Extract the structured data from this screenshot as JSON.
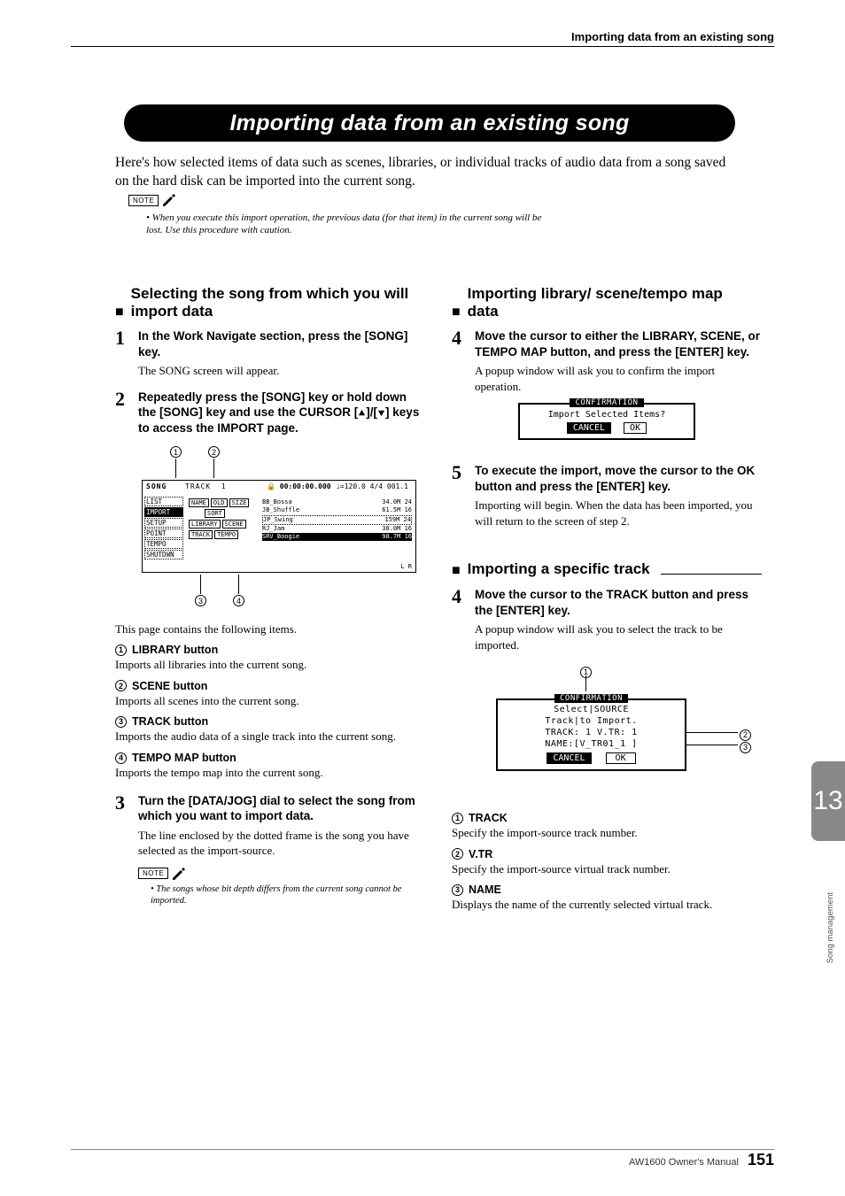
{
  "runhead": "Importing data from an existing song",
  "title": "Importing data from an existing song",
  "intro": "Here's how selected items of data such as scenes, libraries, or individual tracks of audio data from a song saved on the hard disk can be imported into the current song.",
  "noteLabel": "NOTE",
  "note1": "• When you execute this import operation, the previous data (for that item) in the current song will be lost. Use this procedure with caution.",
  "left": {
    "subA": "Selecting the song from which you will import data",
    "step1_bold": "In the Work Navigate section, press the [SONG] key.",
    "step1_body": "The SONG screen will appear.",
    "step2_bold_a": "Repeatedly press the [SONG] key or hold down the [SONG] key and use the CURSOR [",
    "step2_bold_b": "]/[",
    "step2_bold_c": "] keys to access the IMPORT page.",
    "shot": {
      "song": "SONG",
      "track": "TRACK",
      "trackn": "1",
      "time": "00:00:00.000",
      "tempo": "♩=120.0 4/4 001.1",
      "side": [
        "LIST",
        "IMPORT",
        "SETUP",
        "POINT",
        "TEMPO",
        "SHUTDWN"
      ],
      "btns": [
        [
          "NAME",
          "OLD",
          "SIZE"
        ],
        [
          "SORT"
        ],
        [
          "LIBRARY",
          "SCENE"
        ],
        [
          "TRACK",
          "TEMPO"
        ]
      ],
      "rows": [
        {
          "n": "BB_Bossa",
          "v": "34.0M 24",
          "i": "0"
        },
        {
          "n": "JB_Shuffle",
          "v": "61.5M 16",
          "i": "6"
        },
        {
          "n": "JP_Swing",
          "v": "159M 24",
          "i": "12"
        },
        {
          "n": "RJ_Jam",
          "v": "38.0M 16",
          "i": "18"
        },
        {
          "n": "SRV_Boogie",
          "v": "98.7M 16",
          "i": "30"
        }
      ],
      "lr": "L  R",
      "meter": "48"
    },
    "afterShot": "This page contains the following items.",
    "items": [
      {
        "n": "1",
        "h": "LIBRARY button",
        "b": "Imports all libraries into the current song."
      },
      {
        "n": "2",
        "h": "SCENE button",
        "b": "Imports all scenes into the current song."
      },
      {
        "n": "3",
        "h": "TRACK button",
        "b": "Imports the audio data of a single track into the current song."
      },
      {
        "n": "4",
        "h": "TEMPO MAP button",
        "b": "Imports the tempo map into the current song."
      }
    ],
    "step3_bold": "Turn the [DATA/JOG] dial to select the song from which you want to import data.",
    "step3_body": "The line enclosed by the dotted frame is the song you have selected as the import-source.",
    "note2": "• The songs whose bit depth differs from the current song cannot be imported."
  },
  "right": {
    "subB": "Importing library/ scene/tempo map data",
    "step4_bold": "Move the cursor to either the LIBRARY, SCENE, or TEMPO MAP button, and press the [ENTER] key.",
    "step4_body": "A popup window will ask you to confirm the import operation.",
    "confirm1": {
      "hdr": "CONFIRMATION",
      "msg": "Import Selected Items?",
      "cancel": "CANCEL",
      "ok": "OK"
    },
    "step5_bold": "To execute the import, move the cursor to the OK button and press the [ENTER] key.",
    "step5_body": "Importing will begin. When the data has been imported, you will return to the screen of step 2.",
    "subC": "Importing a specific track",
    "step4b_bold": "Move the cursor to the TRACK button and press the [ENTER] key.",
    "step4b_body": "A popup window will ask you to select the track to be imported.",
    "confirm2": {
      "hdr": "CONFIRMATION",
      "l1": "Select|SOURCE",
      "l2": "Track|to Import.",
      "l3": "TRACK: 1  V.TR: 1",
      "l4": "NAME:[V_TR01_1 ]",
      "cancel": "CANCEL",
      "ok": "OK"
    },
    "items2": [
      {
        "n": "1",
        "h": "TRACK",
        "b": "Specify the import-source track number."
      },
      {
        "n": "2",
        "h": "V.TR",
        "b": "Specify the import-source virtual track number."
      },
      {
        "n": "3",
        "h": "NAME",
        "b": "Displays the name of the currently selected virtual track."
      }
    ]
  },
  "sidetab": {
    "num": "13",
    "caption": "Song management"
  },
  "footer": {
    "manual": "AW1600  Owner's Manual",
    "page": "151"
  }
}
